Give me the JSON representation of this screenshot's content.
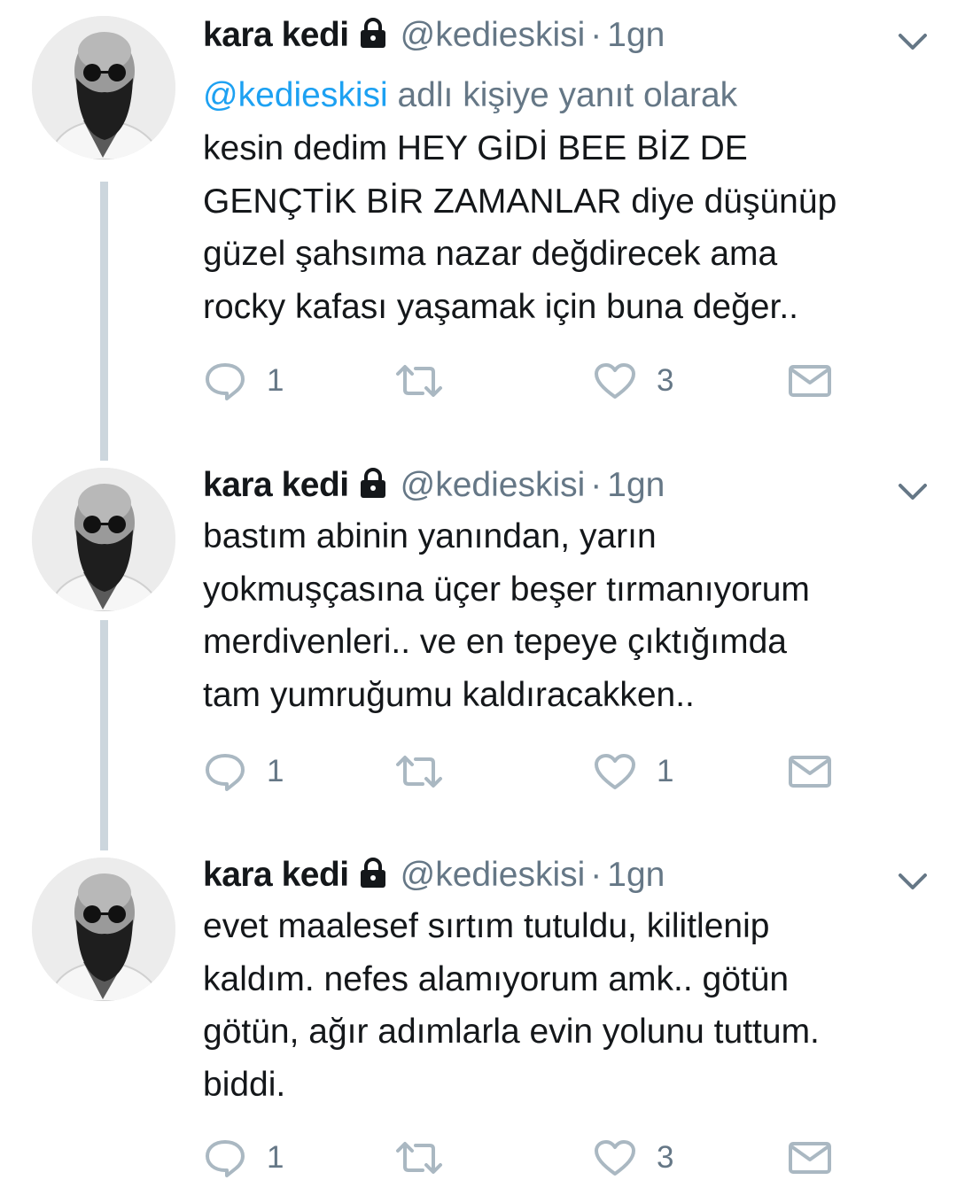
{
  "tweets": [
    {
      "display_name": "kara kedi",
      "handle": "@kedieskisi",
      "separator": "·",
      "time": "1gn",
      "reply_to": {
        "mention": "@kedieskisi",
        "suffix": " adlı kişiye yanıt olarak"
      },
      "text_lines": [
        "kesin dedim HEY GİDİ BEE BİZ DE",
        "GENÇTİK BİR ZAMANLAR diye düşünüp",
        "güzel şahsıma nazar değdirecek ama",
        "rocky kafası yaşamak için buna değer.."
      ],
      "replies": "1",
      "retweets": "",
      "likes": "3"
    },
    {
      "display_name": "kara kedi",
      "handle": "@kedieskisi",
      "separator": "·",
      "time": "1gn",
      "text_lines": [
        "bastım abinin yanından, yarın",
        "yokmuşçasına üçer beşer tırmanıyorum",
        "merdivenleri.. ve en tepeye çıktığımda",
        "tam yumruğumu kaldıracakken.."
      ],
      "replies": "1",
      "retweets": "",
      "likes": "1"
    },
    {
      "display_name": "kara kedi",
      "handle": "@kedieskisi",
      "separator": "·",
      "time": "1gn",
      "text_lines": [
        "evet maalesef sırtım tutuldu, kilitlenip",
        "kaldım. nefes alamıyorum amk.. götün",
        "götün, ağır adımlarla evin yolunu tuttum.",
        "biddi."
      ],
      "replies": "1",
      "retweets": "",
      "likes": "3"
    }
  ],
  "icons": {
    "reply": "reply-icon",
    "retweet": "retweet-icon",
    "like": "heart-icon",
    "dm": "envelope-icon",
    "lock": "lock-icon",
    "menu": "chevron-down-icon"
  },
  "colors": {
    "text": "#14171a",
    "secondary": "#657786",
    "link": "#1da1f2",
    "thread_line": "#ccd6dd",
    "icon": "#aab8c2"
  }
}
